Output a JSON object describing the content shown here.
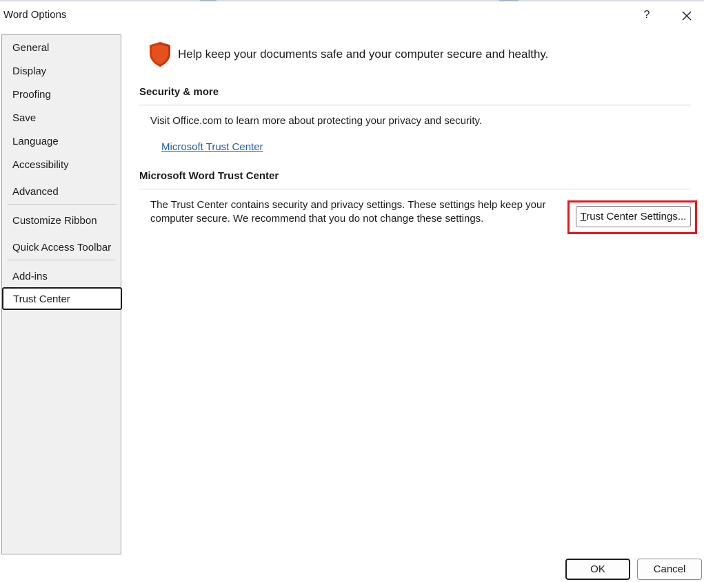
{
  "window": {
    "title": "Word Options",
    "help_label": "?"
  },
  "sidebar": {
    "items": [
      {
        "label": "General"
      },
      {
        "label": "Display"
      },
      {
        "label": "Proofing"
      },
      {
        "label": "Save"
      },
      {
        "label": "Language"
      },
      {
        "label": "Accessibility"
      },
      {
        "label": "Advanced"
      },
      {
        "label": "Customize Ribbon"
      },
      {
        "label": "Quick Access Toolbar"
      },
      {
        "label": "Add-ins"
      },
      {
        "label": "Trust Center",
        "selected": true
      }
    ]
  },
  "main": {
    "header_text": "Help keep your documents safe and your computer secure and healthy.",
    "security_section": {
      "title": "Security & more",
      "description": "Visit Office.com to learn more about protecting your privacy and security.",
      "link": "Microsoft Trust Center"
    },
    "trust_center_section": {
      "title": "Microsoft Word Trust Center",
      "description_line1": "The Trust Center contains security and privacy settings. These settings help keep your",
      "description_line2": "computer secure. We recommend that you do not change these settings.",
      "button_label_underlined": "T",
      "button_label_rest": "rust Center Settings..."
    }
  },
  "footer": {
    "ok_label": "OK",
    "cancel_label": "Cancel"
  },
  "colors": {
    "shield": "#d83b01",
    "link": "#1e5fa8",
    "highlight": "#e8161b",
    "sidebar_bg": "#f0f0f0"
  }
}
